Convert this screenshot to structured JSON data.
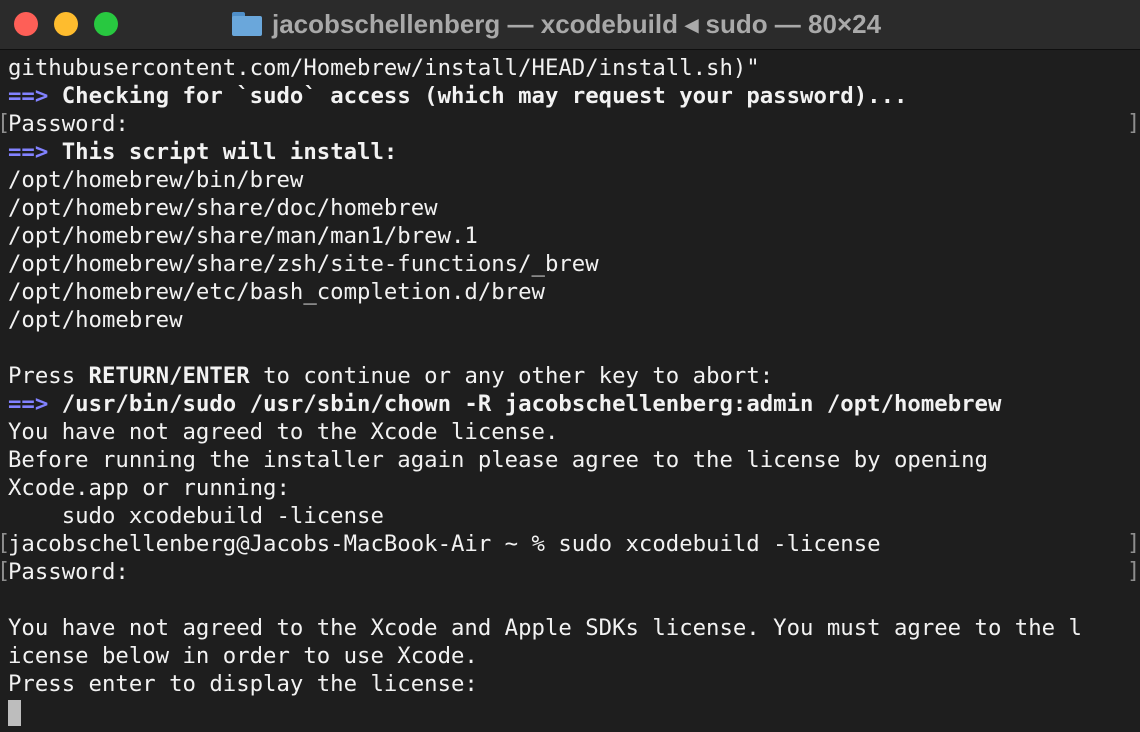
{
  "window": {
    "title": "jacobschellenberg — xcodebuild ◂ sudo — 80×24",
    "folder_icon": "folder-icon",
    "colors": {
      "close": "#fe5f57",
      "minimize": "#febc2e",
      "zoom": "#28c840",
      "arrow": "#8282ff",
      "background": "#1e1e1e",
      "text": "#f2f2f2"
    }
  },
  "terminal": {
    "l1": "githubusercontent.com/Homebrew/install/HEAD/install.sh)\"",
    "arrow": "==>",
    "l2": "Checking for `sudo` access (which may request your password)...",
    "l3": "Password:",
    "l4": "This script will install:",
    "l5": "/opt/homebrew/bin/brew",
    "l6": "/opt/homebrew/share/doc/homebrew",
    "l7": "/opt/homebrew/share/man/man1/brew.1",
    "l8": "/opt/homebrew/share/zsh/site-functions/_brew",
    "l9": "/opt/homebrew/etc/bash_completion.d/brew",
    "l10": "/opt/homebrew",
    "l12a": "Press ",
    "l12b": "RETURN",
    "l12c": "/",
    "l12d": "ENTER",
    "l12e": " to continue or any other key to abort:",
    "l13": "/usr/bin/sudo /usr/sbin/chown -R jacobschellenberg:admin /opt/homebrew",
    "l14": "You have not agreed to the Xcode license.",
    "l15": "Before running the installer again please agree to the license by opening",
    "l16": "Xcode.app or running:",
    "l17": "    sudo xcodebuild -license",
    "l18": "jacobschellenberg@Jacobs-MacBook-Air ~ % sudo xcodebuild -license",
    "l19": "Password:",
    "l21": "You have not agreed to the Xcode and Apple SDKs license. You must agree to the l",
    "l22": "icense below in order to use Xcode.",
    "l23": "Press enter to display the license:",
    "bracket_left": "[",
    "bracket_right": "]"
  }
}
